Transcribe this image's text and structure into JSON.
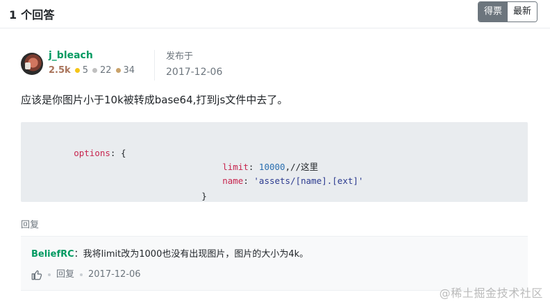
{
  "answers": {
    "title": "1 个回答",
    "sort_options": [
      "得票",
      "最新"
    ],
    "active_sort": "得票"
  },
  "answer": {
    "author": {
      "name": "j_bleach",
      "reputation": "2.5k",
      "medals": {
        "gold": "5",
        "silver": "22",
        "bronze": "34"
      }
    },
    "published_label": "发布于",
    "published_date": "2017-12-06",
    "text": "应该是你图片小于10k被转成base64,打到js文件中去了。",
    "code": {
      "line1_key": "options",
      "line1_rest": ": {",
      "line2_key": "limit",
      "line2_colon": ": ",
      "line2_value": "10000",
      "line2_comment": ",//这里",
      "line3_key": "name",
      "line3_colon": ": ",
      "line3_value": "'assets/[name].[ext]'",
      "line4": "}"
    },
    "reply_label": "回复"
  },
  "comment": {
    "author": "BeliefRC",
    "text": "：我将limit改为1000也没有出现图片，图片的大小为4k。",
    "reply_label": "回复",
    "date": "2017-12-06"
  },
  "watermark": {
    "text": "@稀土掘金技术社区"
  },
  "icon_names": {
    "like": "thumb-up-icon",
    "gold_medal": "gold-medal-icon",
    "silver_medal": "silver-medal-icon",
    "bronze_medal": "bronze-medal-icon"
  },
  "colors": {
    "accent_green": "#009a61",
    "header_border": "#e9ecef",
    "sort_active": "#6c757d"
  }
}
